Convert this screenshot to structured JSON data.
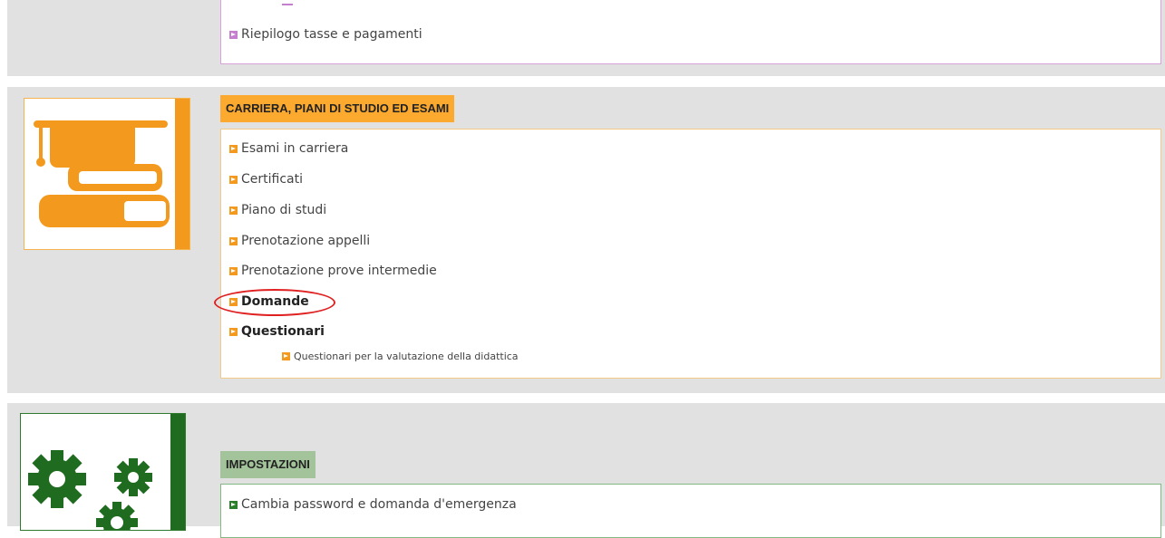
{
  "fees_section": {
    "links": [
      {
        "label": "Riepilogo tasse e pagamenti"
      }
    ]
  },
  "career_section": {
    "title": "CARRIERA, PIANI DI STUDIO ED ESAMI",
    "icon": "graduation-cap-books-icon",
    "links": [
      {
        "label": "Esami in carriera"
      },
      {
        "label": "Certificati"
      },
      {
        "label": "Piano di studi"
      },
      {
        "label": "Prenotazione appelli"
      },
      {
        "label": "Prenotazione prove intermedie"
      },
      {
        "label": "Domande"
      },
      {
        "label": "Questionari"
      }
    ],
    "sublinks": [
      {
        "label": "Questionari per la valutazione della didattica"
      }
    ]
  },
  "settings_section": {
    "title": "IMPOSTAZIONI",
    "icon": "gears-icon",
    "links": [
      {
        "label": "Cambia password e domanda d'emergenza"
      }
    ]
  },
  "colors": {
    "fees_accent": "#c67fcf",
    "career_accent": "#f39a1e",
    "settings_accent": "#2a7d2a",
    "highlight": "#e02020"
  }
}
